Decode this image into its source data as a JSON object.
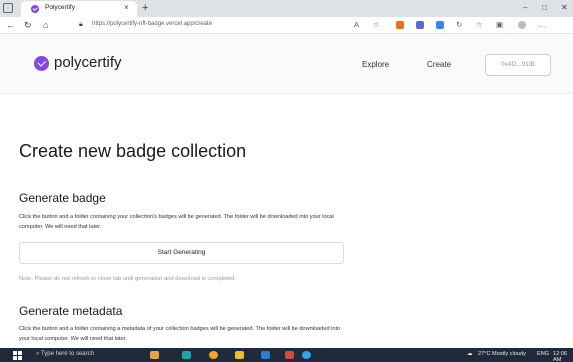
{
  "browser": {
    "tab_title": "Polycertify",
    "close_tab": "×",
    "new_tab": "+",
    "url": "https://polycertify-nft-badge.vercel.app/create",
    "window_controls": [
      "–",
      "□",
      "✕"
    ]
  },
  "header": {
    "brand": "polycertify",
    "nav": [
      "Explore",
      "Create"
    ],
    "wallet": "0x4D...91fB",
    "accent": "#8247e5"
  },
  "main": {
    "title": "Create new badge collection",
    "badge": {
      "heading": "Generate badge",
      "description": "Click the button and a folder containing your collection's badges will be generated. The folder will be downloaded into your local computer. We will need that later.",
      "button": "Start Generating",
      "note": "Note: Please do not refresh or close tab until generation and download is completed."
    },
    "metadata": {
      "heading": "Generate metadata",
      "description": "Click the button and a folder containing a metadata of your collection badges will be generated. The folder will be downloaded into your local computer. We will need that later."
    }
  },
  "taskbar": {
    "search_placeholder": "Type here to search",
    "weather": "27°C  Mostly cloudy",
    "language": "ENG",
    "time": "12:06 AM"
  }
}
